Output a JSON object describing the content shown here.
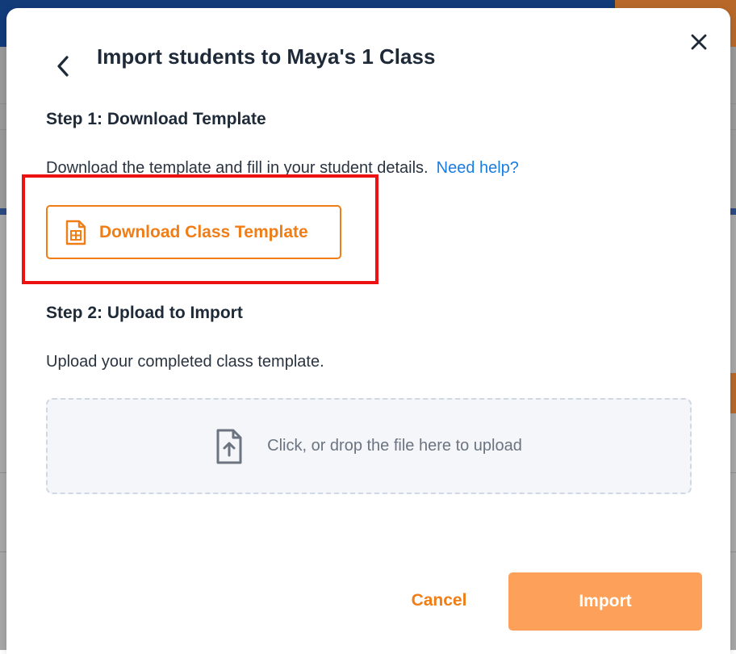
{
  "dialog": {
    "title": "Import students to Maya's 1 Class",
    "back_icon": "chevron-left-icon",
    "close_icon": "close-icon"
  },
  "step1": {
    "title": "Step 1: Download Template",
    "description": "Download the template and fill in your student details.",
    "help_link": "Need help?",
    "download_button": "Download Class Template",
    "download_icon": "spreadsheet-file-icon"
  },
  "step2": {
    "title": "Step 2: Upload to Import",
    "description": "Upload your completed class template.",
    "dropzone_text": "Click, or drop the file here to upload",
    "dropzone_icon": "file-upload-icon"
  },
  "footer": {
    "cancel_label": "Cancel",
    "import_label": "Import"
  },
  "colors": {
    "accent": "#f07d16",
    "import_disabled": "#fda15a",
    "link": "#1a7de0",
    "highlight": "#ee1111"
  }
}
